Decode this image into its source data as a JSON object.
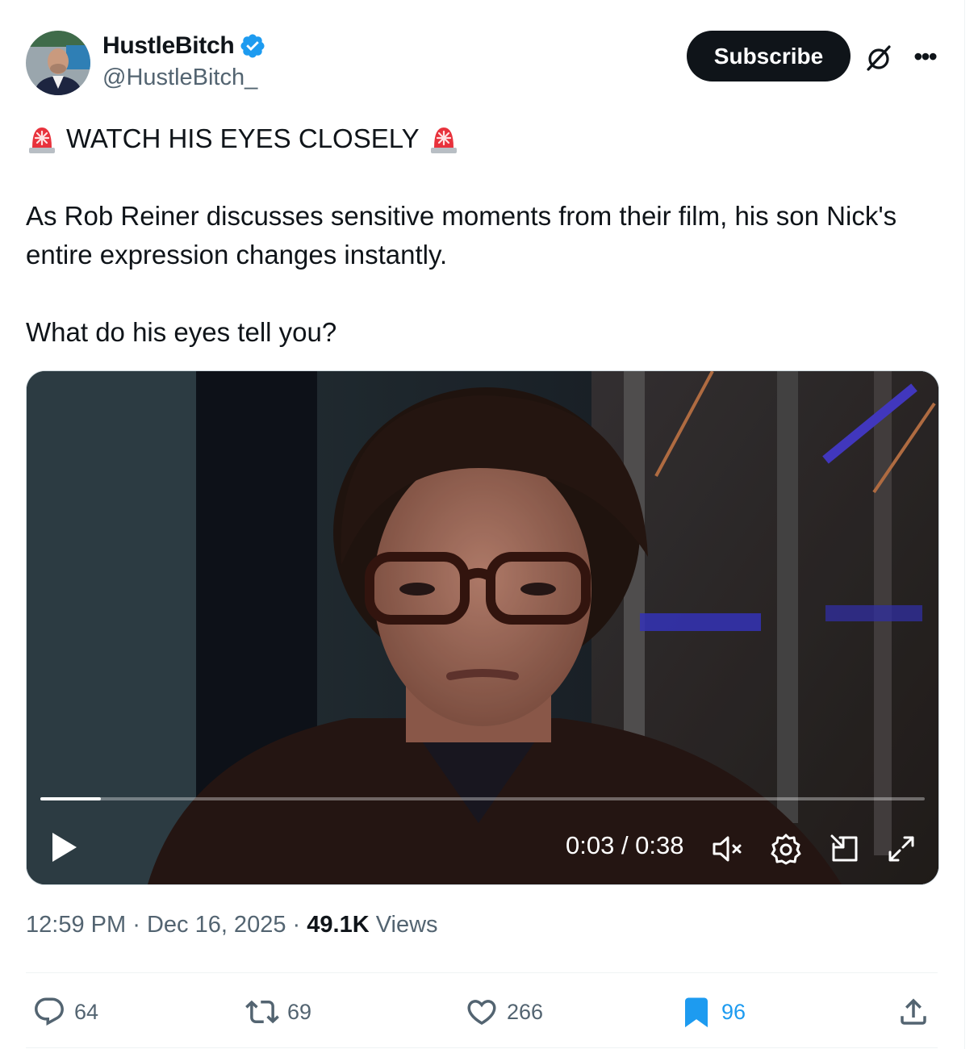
{
  "author": {
    "display_name": "HustleBitch",
    "handle": "@HustleBitch_",
    "verified_icon": "verified-badge-icon"
  },
  "header": {
    "subscribe_label": "Subscribe",
    "grok_icon": "grok-icon",
    "more_icon": "more-icon"
  },
  "tweet": {
    "headline": "WATCH HIS EYES CLOSELY",
    "siren_icon": "police-light-emoji",
    "paragraph1": "As Rob Reiner discusses sensitive moments from their film, his son Nick's entire expression changes instantly.",
    "paragraph2": "What do his eyes tell you?"
  },
  "video": {
    "time_display": "0:03 / 0:38",
    "progress_fraction": 0.068,
    "controls": [
      "play-icon",
      "mute-icon",
      "settings-icon",
      "pip-icon",
      "fullscreen-icon"
    ]
  },
  "meta": {
    "time": "12:59 PM",
    "separator": "·",
    "date": "Dec 16, 2025",
    "views_count": "49.1K",
    "views_label": "Views"
  },
  "actions": {
    "replies": "64",
    "reposts": "69",
    "likes": "266",
    "bookmarks": "96"
  },
  "colors": {
    "text": "#0f1419",
    "secondary": "#536471",
    "verified": "#1d9bf0",
    "bookmark_active": "#1d9bf0",
    "button_bg": "#0f1419"
  }
}
